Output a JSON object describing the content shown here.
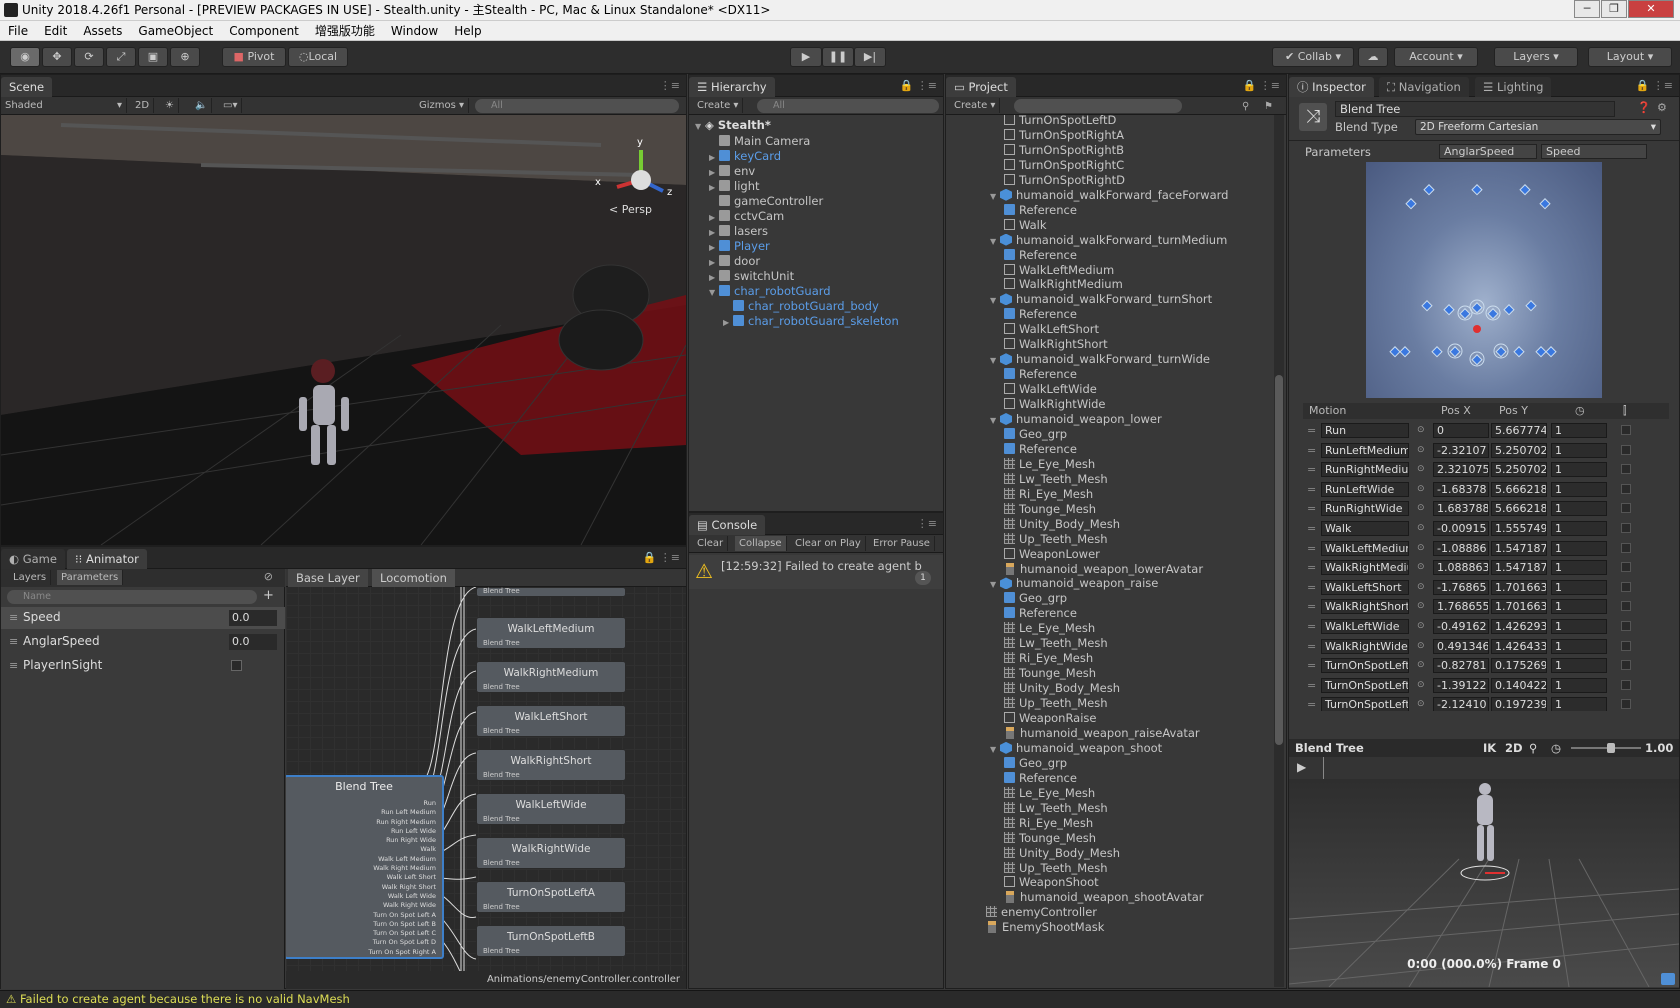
{
  "window": {
    "title": "Unity 2018.4.26f1 Personal - [PREVIEW PACKAGES IN USE] - Stealth.unity - 主Stealth - PC, Mac & Linux Standalone* <DX11>",
    "controls": [
      "─",
      "❐",
      "✕"
    ]
  },
  "menu": [
    "File",
    "Edit",
    "Assets",
    "GameObject",
    "Component",
    "增强版功能",
    "Window",
    "Help"
  ],
  "toolbar": {
    "pivot": "Pivot",
    "local": "Local",
    "collab": "Collab ▾",
    "account": "Account",
    "layers": "Layers",
    "layout": "Layout"
  },
  "scene": {
    "tab": "Scene",
    "shading": "Shaded",
    "mode2d": "2D",
    "gizmos": "Gizmos",
    "search_placeholder": "All",
    "persp": "< Persp",
    "gizmo_x": "x",
    "gizmo_y": "y",
    "gizmo_z": "z"
  },
  "animator": {
    "tab_game": "Game",
    "tab_animator": "Animator",
    "layers_tab": "Layers",
    "params_tab": "Parameters",
    "name_placeholder": "Name",
    "params": [
      {
        "name": "Speed",
        "value": "0.0"
      },
      {
        "name": "AnglarSpeed",
        "value": "0.0"
      },
      {
        "name": "PlayerInSight",
        "value": ""
      }
    ],
    "breadcrumb_base": "Base Layer",
    "breadcrumb_loc": "Locomotion",
    "blend_tree": "Blend Tree",
    "blend_label": "Blend Tree",
    "blend_inputs": [
      "Run",
      "Run Left Medium",
      "Run Right Medium",
      "Run Left Wide",
      "Run Right Wide",
      "Walk",
      "Walk Left Medium",
      "Walk Right Medium",
      "Walk Left Short",
      "Walk Right Short",
      "Walk Left Wide",
      "Walk Right Wide",
      "Turn On Spot Left A",
      "Turn On Spot Left B",
      "Turn On Spot Left C",
      "Turn On Spot Left D",
      "Turn On Spot Right A"
    ],
    "nodes": [
      "WalkLeftMedium",
      "WalkRightMedium",
      "WalkLeftShort",
      "WalkRightShort",
      "WalkLeftWide",
      "WalkRightWide",
      "TurnOnSpotLeftA",
      "TurnOnSpotLeftB"
    ],
    "path": "Animations/enemyController.controller"
  },
  "hierarchy": {
    "tab": "Hierarchy",
    "create": "Create ▾",
    "search_placeholder": "All",
    "scene_name": "Stealth*",
    "items": [
      {
        "label": "Main Camera",
        "blue": false,
        "indent": 1,
        "arrow": ""
      },
      {
        "label": "keyCard",
        "blue": true,
        "indent": 1,
        "arrow": "▶"
      },
      {
        "label": "env",
        "blue": false,
        "indent": 1,
        "arrow": "▶"
      },
      {
        "label": "light",
        "blue": false,
        "indent": 1,
        "arrow": "▶"
      },
      {
        "label": "gameController",
        "blue": false,
        "indent": 1,
        "arrow": ""
      },
      {
        "label": "cctvCam",
        "blue": false,
        "indent": 1,
        "arrow": "▶"
      },
      {
        "label": "lasers",
        "blue": false,
        "indent": 1,
        "arrow": "▶"
      },
      {
        "label": "Player",
        "blue": true,
        "indent": 1,
        "arrow": "▶"
      },
      {
        "label": "door",
        "blue": false,
        "indent": 1,
        "arrow": "▶"
      },
      {
        "label": "switchUnit",
        "blue": false,
        "indent": 1,
        "arrow": "▶"
      },
      {
        "label": "char_robotGuard",
        "blue": true,
        "indent": 1,
        "arrow": "▼"
      },
      {
        "label": "char_robotGuard_body",
        "blue": true,
        "indent": 2,
        "arrow": ""
      },
      {
        "label": "char_robotGuard_skeleton",
        "blue": true,
        "indent": 2,
        "arrow": "▶"
      }
    ]
  },
  "console": {
    "tab": "Console",
    "buttons": [
      "Clear",
      "Collapse",
      "Clear on Play",
      "Error Pause"
    ],
    "message": "[12:59:32] Failed to create agent b",
    "count": "1"
  },
  "project": {
    "tab": "Project",
    "create": "Create ▾",
    "items": [
      {
        "label": "TurnOnSpotLeftD",
        "type": "clip",
        "indent": 2
      },
      {
        "label": "TurnOnSpotRightA",
        "type": "clip",
        "indent": 2
      },
      {
        "label": "TurnOnSpotRightB",
        "type": "clip",
        "indent": 2
      },
      {
        "label": "TurnOnSpotRightC",
        "type": "clip",
        "indent": 2
      },
      {
        "label": "TurnOnSpotRightD",
        "type": "clip",
        "indent": 2
      },
      {
        "label": "humanoid_walkForward_faceForward",
        "type": "fbx",
        "indent": 1
      },
      {
        "label": "Reference",
        "type": "prefab",
        "indent": 2
      },
      {
        "label": "Walk",
        "type": "clip",
        "indent": 2
      },
      {
        "label": "humanoid_walkForward_turnMedium",
        "type": "fbx",
        "indent": 1
      },
      {
        "label": "Reference",
        "type": "prefab",
        "indent": 2
      },
      {
        "label": "WalkLeftMedium",
        "type": "clip",
        "indent": 2
      },
      {
        "label": "WalkRightMedium",
        "type": "clip",
        "indent": 2
      },
      {
        "label": "humanoid_walkForward_turnShort",
        "type": "fbx",
        "indent": 1
      },
      {
        "label": "Reference",
        "type": "prefab",
        "indent": 2
      },
      {
        "label": "WalkLeftShort",
        "type": "clip",
        "indent": 2
      },
      {
        "label": "WalkRightShort",
        "type": "clip",
        "indent": 2
      },
      {
        "label": "humanoid_walkForward_turnWide",
        "type": "fbx",
        "indent": 1
      },
      {
        "label": "Reference",
        "type": "prefab",
        "indent": 2
      },
      {
        "label": "WalkLeftWide",
        "type": "clip",
        "indent": 2
      },
      {
        "label": "WalkRightWide",
        "type": "clip",
        "indent": 2
      },
      {
        "label": "humanoid_weapon_lower",
        "type": "fbx",
        "indent": 1
      },
      {
        "label": "Geo_grp",
        "type": "prefab",
        "indent": 2
      },
      {
        "label": "Reference",
        "type": "prefab",
        "indent": 2
      },
      {
        "label": "Le_Eye_Mesh",
        "type": "mesh",
        "indent": 2
      },
      {
        "label": "Lw_Teeth_Mesh",
        "type": "mesh",
        "indent": 2
      },
      {
        "label": "Ri_Eye_Mesh",
        "type": "mesh",
        "indent": 2
      },
      {
        "label": "Tounge_Mesh",
        "type": "mesh",
        "indent": 2
      },
      {
        "label": "Unity_Body_Mesh",
        "type": "mesh",
        "indent": 2
      },
      {
        "label": "Up_Teeth_Mesh",
        "type": "mesh",
        "indent": 2
      },
      {
        "label": "WeaponLower",
        "type": "clip",
        "indent": 2
      },
      {
        "label": "humanoid_weapon_lowerAvatar",
        "type": "avatar",
        "indent": 2
      },
      {
        "label": "humanoid_weapon_raise",
        "type": "fbx",
        "indent": 1
      },
      {
        "label": "Geo_grp",
        "type": "prefab",
        "indent": 2
      },
      {
        "label": "Reference",
        "type": "prefab",
        "indent": 2
      },
      {
        "label": "Le_Eye_Mesh",
        "type": "mesh",
        "indent": 2
      },
      {
        "label": "Lw_Teeth_Mesh",
        "type": "mesh",
        "indent": 2
      },
      {
        "label": "Ri_Eye_Mesh",
        "type": "mesh",
        "indent": 2
      },
      {
        "label": "Tounge_Mesh",
        "type": "mesh",
        "indent": 2
      },
      {
        "label": "Unity_Body_Mesh",
        "type": "mesh",
        "indent": 2
      },
      {
        "label": "Up_Teeth_Mesh",
        "type": "mesh",
        "indent": 2
      },
      {
        "label": "WeaponRaise",
        "type": "clip",
        "indent": 2
      },
      {
        "label": "humanoid_weapon_raiseAvatar",
        "type": "avatar",
        "indent": 2
      },
      {
        "label": "humanoid_weapon_shoot",
        "type": "fbx",
        "indent": 1
      },
      {
        "label": "Geo_grp",
        "type": "prefab",
        "indent": 2
      },
      {
        "label": "Reference",
        "type": "prefab",
        "indent": 2
      },
      {
        "label": "Le_Eye_Mesh",
        "type": "mesh",
        "indent": 2
      },
      {
        "label": "Lw_Teeth_Mesh",
        "type": "mesh",
        "indent": 2
      },
      {
        "label": "Ri_Eye_Mesh",
        "type": "mesh",
        "indent": 2
      },
      {
        "label": "Tounge_Mesh",
        "type": "mesh",
        "indent": 2
      },
      {
        "label": "Unity_Body_Mesh",
        "type": "mesh",
        "indent": 2
      },
      {
        "label": "Up_Teeth_Mesh",
        "type": "mesh",
        "indent": 2
      },
      {
        "label": "WeaponShoot",
        "type": "clip",
        "indent": 2
      },
      {
        "label": "humanoid_weapon_shootAvatar",
        "type": "avatar",
        "indent": 2
      },
      {
        "label": "enemyController",
        "type": "controller",
        "indent": 0
      },
      {
        "label": "EnemyShootMask",
        "type": "mask",
        "indent": 0
      }
    ]
  },
  "inspector": {
    "tab_inspector": "Inspector",
    "tab_navigation": "Navigation",
    "tab_lighting": "Lighting",
    "name": "Blend Tree",
    "blend_type_label": "Blend Type",
    "blend_type": "2D Freeform Cartesian",
    "parameters_label": "Parameters",
    "param_x": "AnglarSpeed",
    "param_y": "Speed",
    "col_motion": "Motion",
    "col_posx": "Pos X",
    "col_posy": "Pos Y",
    "motions": [
      {
        "name": "Run",
        "x": "0",
        "y": "5.667774",
        "s": "1"
      },
      {
        "name": "RunLeftMedium",
        "x": "-2.32107",
        "y": "5.250702",
        "s": "1"
      },
      {
        "name": "RunRightMedium",
        "x": "2.321075",
        "y": "5.250702",
        "s": "1"
      },
      {
        "name": "RunLeftWide",
        "x": "-1.68378",
        "y": "5.666218",
        "s": "1"
      },
      {
        "name": "RunRightWide",
        "x": "1.683788",
        "y": "5.666218",
        "s": "1"
      },
      {
        "name": "Walk",
        "x": "-0.00915",
        "y": "1.555749",
        "s": "1"
      },
      {
        "name": "WalkLeftMedium",
        "x": "-1.08886",
        "y": "1.547187",
        "s": "1"
      },
      {
        "name": "WalkRightMedium",
        "x": "1.088863",
        "y": "1.547187",
        "s": "1"
      },
      {
        "name": "WalkLeftShort",
        "x": "-1.76865",
        "y": "1.701663",
        "s": "1"
      },
      {
        "name": "WalkRightShort",
        "x": "1.768655",
        "y": "1.701663",
        "s": "1"
      },
      {
        "name": "WalkLeftWide",
        "x": "-0.49162",
        "y": "1.426293",
        "s": "1"
      },
      {
        "name": "WalkRightWide",
        "x": "0.491346",
        "y": "1.426433",
        "s": "1"
      },
      {
        "name": "TurnOnSpotLeftA",
        "x": "-0.82781",
        "y": "0.175269",
        "s": "1"
      },
      {
        "name": "TurnOnSpotLeftB",
        "x": "-1.39122",
        "y": "0.140422",
        "s": "1"
      },
      {
        "name": "TurnOnSpotLeftC",
        "x": "-2.12410",
        "y": "0.197239",
        "s": "1"
      }
    ],
    "preview_title": "Blend Tree",
    "preview_ik": "IK",
    "preview_2d": "2D",
    "preview_speed": "1.00",
    "preview_time": "0:00 (000.0%) Frame 0"
  },
  "status": "⚠ Failed to create agent because there is no valid NavMesh"
}
